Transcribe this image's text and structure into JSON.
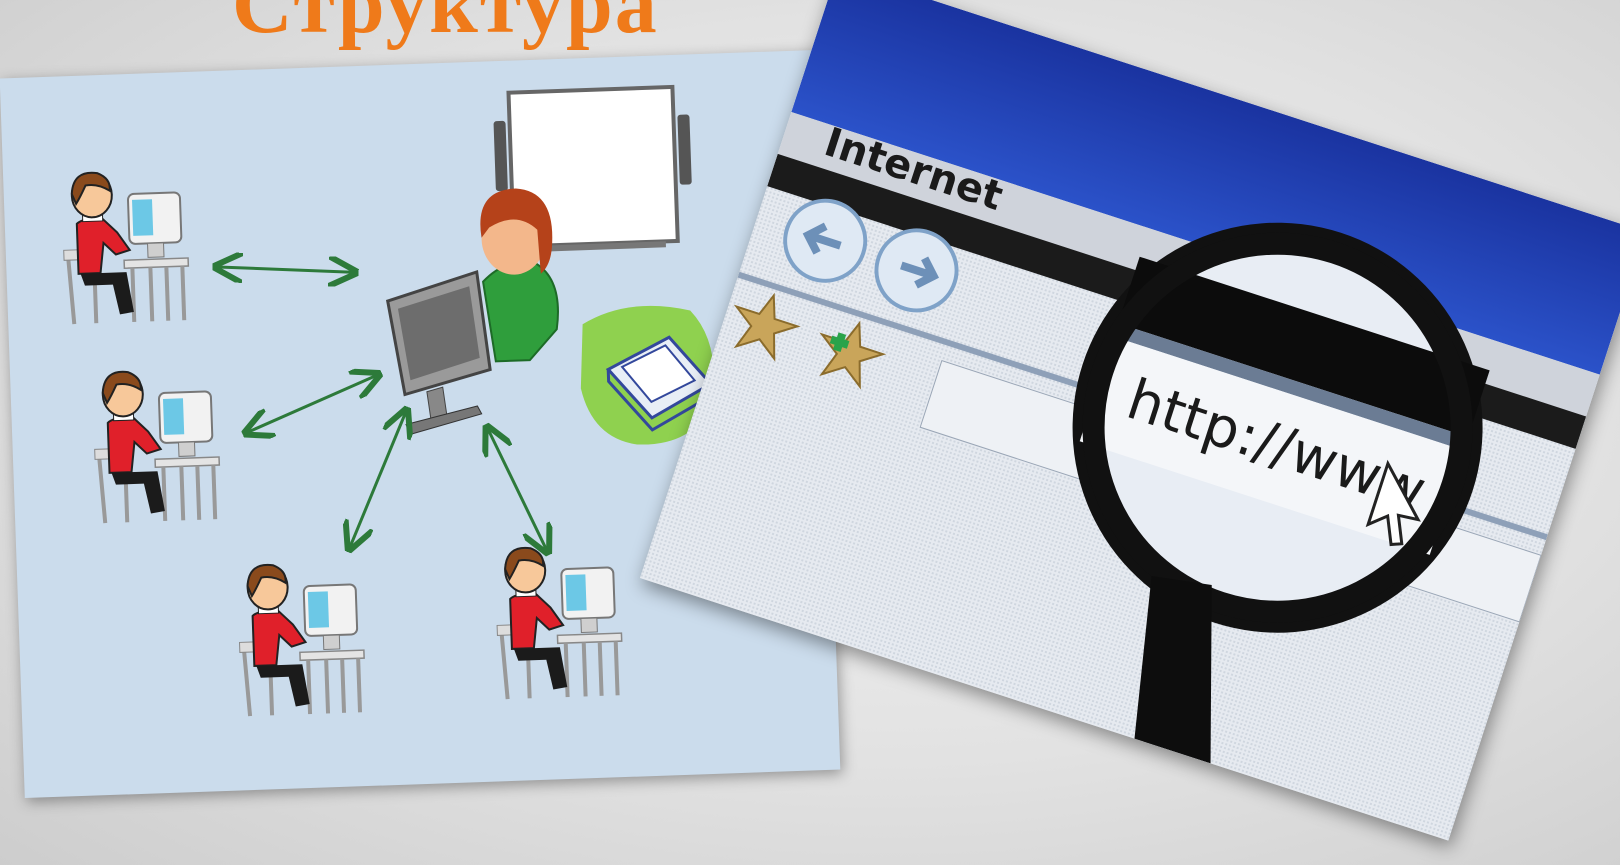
{
  "slide": {
    "title": "Структура",
    "images": [
      {
        "name": "classroom-network-illustration"
      },
      {
        "name": "browser-magnifier-photo",
        "labels": {
          "browser_brand": "Internet",
          "address_text": "http://www"
        }
      }
    ]
  },
  "colors": {
    "title": "#ef7a1a",
    "arrows": "#2d7a3a",
    "photo_blue": "#1e3fa8"
  },
  "icons": [
    "student-at-computer-icon",
    "teacher-at-computer-icon",
    "interactive-whiteboard-icon",
    "scanner-icon",
    "back-arrow-icon",
    "forward-arrow-icon",
    "favorites-star-icon",
    "add-favorite-icon",
    "magnifying-glass-icon",
    "mouse-pointer-icon"
  ]
}
